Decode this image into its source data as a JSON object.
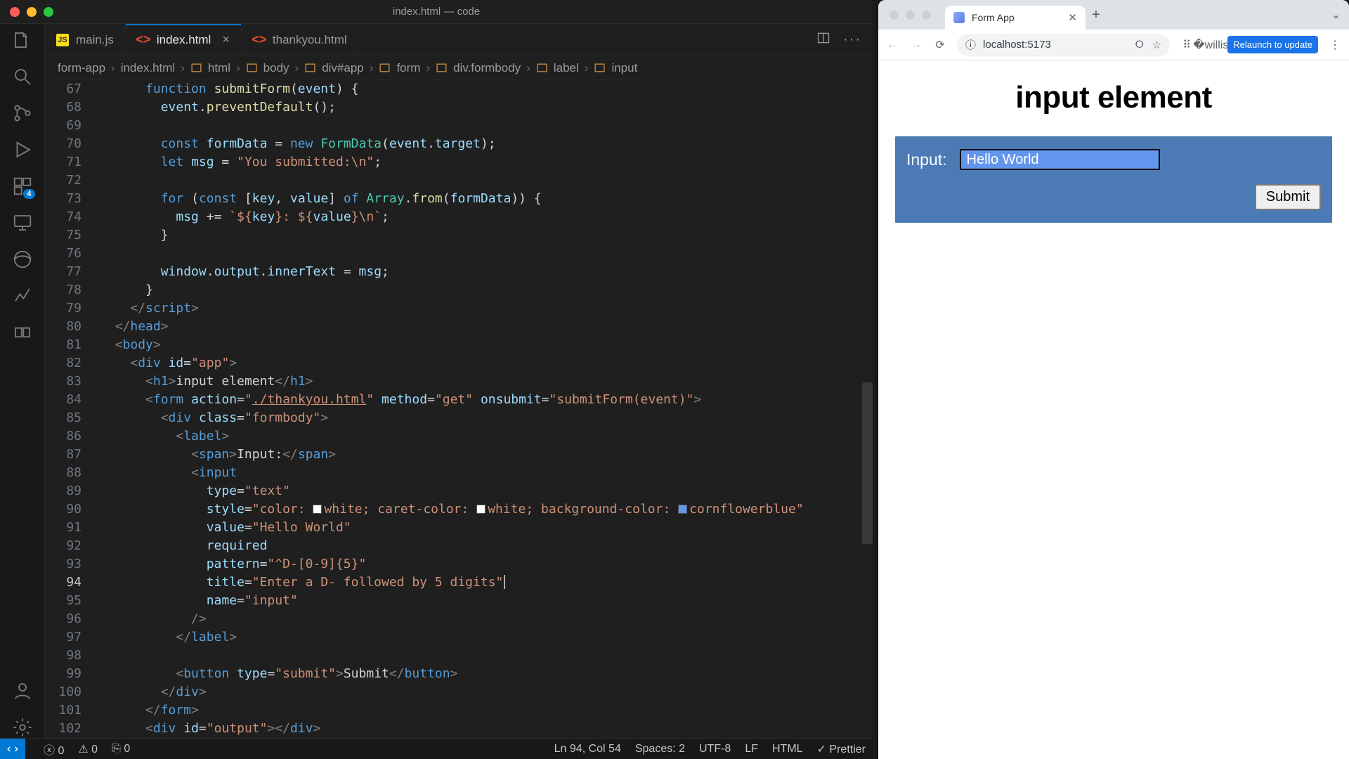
{
  "vscode": {
    "title": "index.html — code",
    "activity_badge": "4",
    "tabs": [
      {
        "icon": "js",
        "label": "main.js",
        "active": false,
        "closeable": false
      },
      {
        "icon": "html5",
        "label": "index.html",
        "active": true,
        "closeable": true
      },
      {
        "icon": "html5",
        "label": "thankyou.html",
        "active": false,
        "closeable": false
      }
    ],
    "breadcrumb": [
      "form-app",
      "index.html",
      "html",
      "body",
      "div#app",
      "form",
      "div.formbody",
      "label",
      "input"
    ],
    "lines": {
      "start": 67,
      "cursor_line": 94,
      "items": [
        {
          "n": 67,
          "html": "      <span class='kw'>function</span> <span class='fn'>submitForm</span><span class='pun'>(</span><span class='var'>event</span><span class='pun'>) {</span>"
        },
        {
          "n": 68,
          "html": "        <span class='var'>event</span><span class='pun'>.</span><span class='fn'>preventDefault</span><span class='pun'>();</span>"
        },
        {
          "n": 69,
          "html": " "
        },
        {
          "n": 70,
          "html": "        <span class='kw'>const</span> <span class='var'>formData</span> <span class='op'>=</span> <span class='kw'>new</span> <span class='cls'>FormData</span><span class='pun'>(</span><span class='var'>event</span><span class='pun'>.</span><span class='var'>target</span><span class='pun'>);</span>"
        },
        {
          "n": 71,
          "html": "        <span class='kw'>let</span> <span class='var'>msg</span> <span class='op'>=</span> <span class='str'>\"You submitted:\\n\"</span><span class='pun'>;</span>"
        },
        {
          "n": 72,
          "html": " "
        },
        {
          "n": 73,
          "html": "        <span class='kw'>for</span> <span class='pun'>(</span><span class='kw'>const</span> <span class='pun'>[</span><span class='var'>key</span><span class='pun'>,</span> <span class='var'>value</span><span class='pun'>]</span> <span class='kw'>of</span> <span class='cls'>Array</span><span class='pun'>.</span><span class='fn'>from</span><span class='pun'>(</span><span class='var'>formData</span><span class='pun'>)) {</span>"
        },
        {
          "n": 74,
          "html": "          <span class='var'>msg</span> <span class='op'>+=</span> <span class='tmpl'>`${'${'}<span class='tmplvar'>key</span>${'}'}: ${'${'}<span class='tmplvar'>value</span>${'}'}\\n`</span><span class='pun'>;</span>"
        },
        {
          "n": 75,
          "html": "        <span class='pun'>}</span>"
        },
        {
          "n": 76,
          "html": " "
        },
        {
          "n": 77,
          "html": "        <span class='var'>window</span><span class='pun'>.</span><span class='var'>output</span><span class='pun'>.</span><span class='var'>innerText</span> <span class='op'>=</span> <span class='var'>msg</span><span class='pun'>;</span>"
        },
        {
          "n": 78,
          "html": "      <span class='pun'>}</span>"
        },
        {
          "n": 79,
          "html": "    <span class='ang'>&lt;/</span><span class='tag'>script</span><span class='ang'>&gt;</span>"
        },
        {
          "n": 80,
          "html": "  <span class='ang'>&lt;/</span><span class='tag'>head</span><span class='ang'>&gt;</span>"
        },
        {
          "n": 81,
          "html": "  <span class='ang'>&lt;</span><span class='tag'>body</span><span class='ang'>&gt;</span>"
        },
        {
          "n": 82,
          "html": "    <span class='ang'>&lt;</span><span class='tag'>div</span> <span class='attr'>id</span><span class='pun'>=</span><span class='str'>\"app\"</span><span class='ang'>&gt;</span>"
        },
        {
          "n": 83,
          "html": "      <span class='ang'>&lt;</span><span class='tag'>h1</span><span class='ang'>&gt;</span>input element<span class='ang'>&lt;/</span><span class='tag'>h1</span><span class='ang'>&gt;</span>"
        },
        {
          "n": 84,
          "html": "      <span class='ang'>&lt;</span><span class='tag'>form</span> <span class='attr'>action</span><span class='pun'>=</span><span class='str'>\"<u>./thankyou.html</u>\"</span> <span class='attr'>method</span><span class='pun'>=</span><span class='str'>\"get\"</span> <span class='attr'>onsubmit</span><span class='pun'>=</span><span class='str'>\"submitForm(event)\"</span><span class='ang'>&gt;</span>"
        },
        {
          "n": 85,
          "html": "        <span class='ang'>&lt;</span><span class='tag'>div</span> <span class='attr'>class</span><span class='pun'>=</span><span class='str'>\"formbody\"</span><span class='ang'>&gt;</span>"
        },
        {
          "n": 86,
          "html": "          <span class='ang'>&lt;</span><span class='tag'>label</span><span class='ang'>&gt;</span>"
        },
        {
          "n": 87,
          "html": "            <span class='ang'>&lt;</span><span class='tag'>span</span><span class='ang'>&gt;</span>Input:<span class='ang'>&lt;/</span><span class='tag'>span</span><span class='ang'>&gt;</span>"
        },
        {
          "n": 88,
          "html": "            <span class='ang'>&lt;</span><span class='tag'>input</span>"
        },
        {
          "n": 89,
          "html": "              <span class='attr'>type</span><span class='pun'>=</span><span class='str'>\"text\"</span>"
        },
        {
          "n": 90,
          "html": "              <span class='attr'>style</span><span class='pun'>=</span><span class='str'>\"color: <span class='swatch' style='background:#fff'></span>white; caret-color: <span class='swatch' style='background:#fff'></span>white; background-color: <span class='swatch' style='background:#6495ed'></span>cornflowerblue\"</span>"
        },
        {
          "n": 91,
          "html": "              <span class='attr'>value</span><span class='pun'>=</span><span class='str'>\"Hello World\"</span>"
        },
        {
          "n": 92,
          "html": "              <span class='attr'>required</span>"
        },
        {
          "n": 93,
          "html": "              <span class='attr'>pattern</span><span class='pun'>=</span><span class='str'>\"^D-[0-9]{5}\"</span> <span class='hand'></span>"
        },
        {
          "n": 94,
          "html": "              <span class='attr'>title</span><span class='pun'>=</span><span class='str'>\"Enter a D- followed by 5 digits\"</span><span class='caret'></span>"
        },
        {
          "n": 95,
          "html": "              <span class='attr'>name</span><span class='pun'>=</span><span class='str'>\"input\"</span>"
        },
        {
          "n": 96,
          "html": "            <span class='ang'>/&gt;</span>"
        },
        {
          "n": 97,
          "html": "          <span class='ang'>&lt;/</span><span class='tag'>label</span><span class='ang'>&gt;</span>"
        },
        {
          "n": 98,
          "html": " "
        },
        {
          "n": 99,
          "html": "          <span class='ang'>&lt;</span><span class='tag'>button</span> <span class='attr'>type</span><span class='pun'>=</span><span class='str'>\"submit\"</span><span class='ang'>&gt;</span>Submit<span class='ang'>&lt;/</span><span class='tag'>button</span><span class='ang'>&gt;</span>"
        },
        {
          "n": 100,
          "html": "        <span class='ang'>&lt;/</span><span class='tag'>div</span><span class='ang'>&gt;</span>"
        },
        {
          "n": 101,
          "html": "      <span class='ang'>&lt;/</span><span class='tag'>form</span><span class='ang'>&gt;</span>"
        },
        {
          "n": 102,
          "html": "      <span class='ang'>&lt;</span><span class='tag'>div</span> <span class='attr'>id</span><span class='pun'>=</span><span class='str'>\"output\"</span><span class='ang'>&gt;&lt;/</span><span class='tag'>div</span><span class='ang'>&gt;</span>"
        }
      ]
    },
    "status": {
      "errors": "0",
      "warnings": "0",
      "ports": "0",
      "cursor": "Ln 94, Col 54",
      "spaces": "Spaces: 2",
      "encoding": "UTF-8",
      "eol": "LF",
      "lang": "HTML",
      "formatter": "Prettier"
    }
  },
  "browser": {
    "tab_title": "Form App",
    "url": "localhost:5173",
    "relaunch": "Relaunch to update",
    "page": {
      "heading": "input element",
      "label": "Input:",
      "value": "Hello World",
      "submit": "Submit"
    }
  }
}
